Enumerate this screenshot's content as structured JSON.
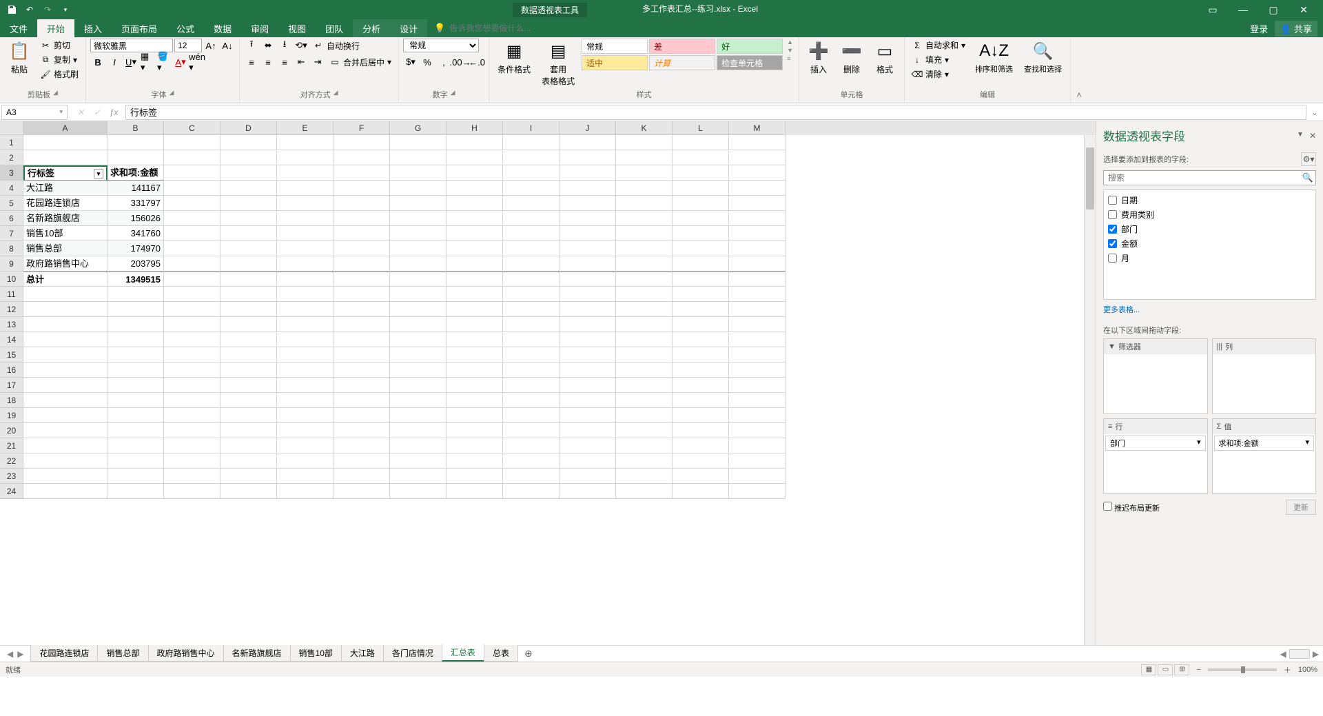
{
  "titlebar": {
    "contextual_tool": "数据透视表工具",
    "title": "多工作表汇总--练习.xlsx - Excel"
  },
  "ribbon_tabs": {
    "file": "文件",
    "home": "开始",
    "insert": "插入",
    "pagelayout": "页面布局",
    "formulas": "公式",
    "data": "数据",
    "review": "审阅",
    "view": "视图",
    "team": "团队",
    "analyze": "分析",
    "design": "设计",
    "tell_me_placeholder": "告诉我您想要做什么...",
    "login": "登录",
    "share": "共享"
  },
  "ribbon": {
    "clipboard": {
      "paste": "粘贴",
      "cut": "剪切",
      "copy": "复制",
      "format_painter": "格式刷",
      "label": "剪贴板"
    },
    "font": {
      "name": "微软雅黑",
      "size": "12",
      "label": "字体"
    },
    "alignment": {
      "wrap": "自动换行",
      "merge": "合并后居中",
      "label": "对齐方式"
    },
    "number": {
      "format": "常规",
      "label": "数字"
    },
    "styles": {
      "cond": "条件格式",
      "table": "套用\n表格格式",
      "normal": "常规",
      "bad": "差",
      "good": "好",
      "neutral": "适中",
      "calc": "计算",
      "check": "检查单元格",
      "label": "样式"
    },
    "cells": {
      "insert": "插入",
      "delete": "删除",
      "format": "格式",
      "label": "单元格"
    },
    "editing": {
      "autosum": "自动求和",
      "fill": "填充",
      "clear": "清除",
      "sort": "排序和筛选",
      "find": "查找和选择",
      "label": "编辑"
    }
  },
  "name_box": "A3",
  "formula_bar": "行标签",
  "columns": [
    "A",
    "B",
    "C",
    "D",
    "E",
    "F",
    "G",
    "H",
    "I",
    "J",
    "K",
    "L",
    "M"
  ],
  "pivot": {
    "header_row_label": "行标签",
    "header_value_label": "求和项:金额",
    "rows": [
      {
        "label": "大江路",
        "value": 141167
      },
      {
        "label": "花园路连锁店",
        "value": 331797
      },
      {
        "label": "名新路旗舰店",
        "value": 156026
      },
      {
        "label": "销售10部",
        "value": 341760
      },
      {
        "label": "销售总部",
        "value": 174970
      },
      {
        "label": "政府路销售中心",
        "value": 203795
      }
    ],
    "total_label": "总计",
    "total_value": 1349515
  },
  "side_panel": {
    "title": "数据透视表字段",
    "choose_label": "选择要添加到报表的字段:",
    "search_placeholder": "搜索",
    "fields": [
      {
        "name": "日期",
        "checked": false
      },
      {
        "name": "费用类别",
        "checked": false
      },
      {
        "name": "部门",
        "checked": true
      },
      {
        "name": "金额",
        "checked": true
      },
      {
        "name": "月",
        "checked": false
      }
    ],
    "more_tables": "更多表格...",
    "drag_label": "在以下区域间拖动字段:",
    "area_filters": "筛选器",
    "area_columns": "列",
    "area_rows": "行",
    "area_values": "值",
    "row_item": "部门",
    "value_item": "求和项:金额",
    "defer": "推迟布局更新",
    "update": "更新"
  },
  "sheets": [
    "花园路连锁店",
    "销售总部",
    "政府路销售中心",
    "名新路旗舰店",
    "销售10部",
    "大江路",
    "各门店情况",
    "汇总表",
    "总表"
  ],
  "active_sheet": "汇总表",
  "status": {
    "ready": "就绪",
    "zoom": "100%"
  },
  "chart_data": {
    "type": "table",
    "title": "求和项:金额 by 部门",
    "categories": [
      "大江路",
      "花园路连锁店",
      "名新路旗舰店",
      "销售10部",
      "销售总部",
      "政府路销售中心"
    ],
    "values": [
      141167,
      331797,
      156026,
      341760,
      174970,
      203795
    ],
    "total": 1349515
  }
}
